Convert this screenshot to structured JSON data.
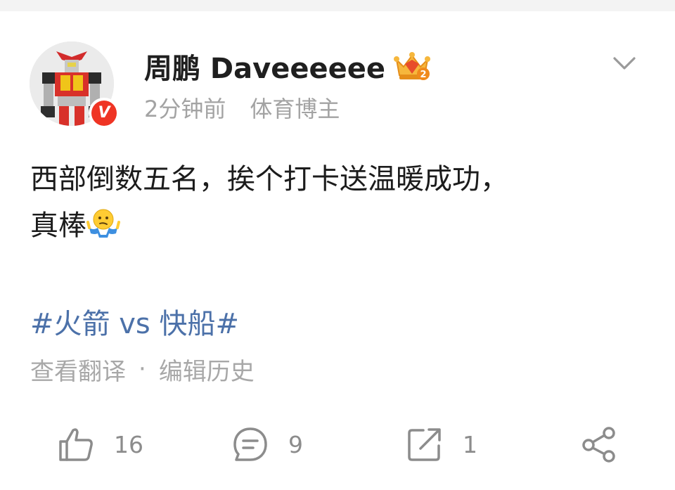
{
  "post": {
    "username": "周鹏 Daveeeeee",
    "time": "2分钟前",
    "source": "体育博主",
    "text_line1": "西部倒数五名，挨个打卡送温暖成功，",
    "text_line2": "真棒",
    "hashtag": "#火箭 vs 快船#",
    "translate": "查看翻译",
    "separator": "·",
    "edit_history": "编辑历史"
  },
  "badges": {
    "verified": "V",
    "verified_color": "#ef3424",
    "crown_level": "2"
  },
  "icons": {
    "verified": "verified-v-badge",
    "crown": "crown-icon",
    "more": "chevron-down-icon",
    "emoji": "shrug-emoji",
    "like": "thumbs-up-icon",
    "comment": "comment-icon",
    "repost": "repost-icon",
    "share": "share-icon"
  },
  "actions": {
    "like_count": "16",
    "comment_count": "9",
    "repost_count": "1"
  },
  "colors": {
    "hashtag": "#4c71a9",
    "meta_text": "#a3a3a3",
    "icon_gray": "#8c8c8c"
  }
}
